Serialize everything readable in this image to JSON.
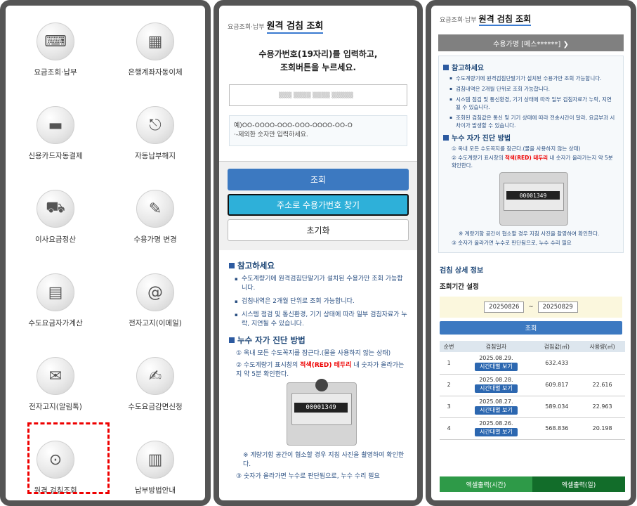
{
  "panel1": {
    "menu": [
      {
        "label": "요금조회·납부",
        "icon": "keyboard-icon",
        "glyph": "⌨"
      },
      {
        "label": "은행계좌자동이체",
        "icon": "calculator-icon",
        "glyph": "▦"
      },
      {
        "label": "신용카드자동결제",
        "icon": "credit-card-icon",
        "glyph": "▬"
      },
      {
        "label": "자동납부해지",
        "icon": "esc-key-icon",
        "glyph": "⎋"
      },
      {
        "label": "이사요금정산",
        "icon": "truck-icon",
        "glyph": "⛟"
      },
      {
        "label": "수용가명 변경",
        "icon": "pen-icon",
        "glyph": "✎"
      },
      {
        "label": "수도요금자가계산",
        "icon": "calculator-icon",
        "glyph": "▤"
      },
      {
        "label": "전자고지(이메일)",
        "icon": "email-at-icon",
        "glyph": "@"
      },
      {
        "label": "전자고지(알림톡)",
        "icon": "talk-icon",
        "glyph": "✉"
      },
      {
        "label": "수도요금감면신청",
        "icon": "document-pen-icon",
        "glyph": "✍"
      },
      {
        "label": "원격 검침조회",
        "icon": "water-meter-icon",
        "glyph": "⊙"
      },
      {
        "label": "납부방법안내",
        "icon": "book-icon",
        "glyph": "▥"
      }
    ]
  },
  "panel2": {
    "breadcrumb": "요금조회·납부",
    "title": "원격 검침 조회",
    "instruction_line1": "수용가번호(19자리)를 입력하고,",
    "instruction_line2": "조회버튼을 누르세요.",
    "input_value": "▒▒▒ ▒▒▒▒ ▒▒▒▒ ▒▒▒▒▒",
    "example_line1": "예)OO-OOOO-OOO-OOO-OOOO-OO-O",
    "example_line2": "·-제외한 숫자만 입력하세요.",
    "search_button": "조회",
    "find_by_address_button": "주소로 수용가번호 찾기",
    "reset_button": "초기화",
    "notes_title": "참고하세요",
    "notes": [
      "수도계량기에 원격검침단말기가 설치된 수용가만 조회 가능합니다.",
      "검침내역은 2개월 단위로 조회 가능합니다.",
      "시스템 점검 및 통신환경, 기기 상태에 따라 일부 검침자료가 누락, 지연될 수 있습니다."
    ],
    "leak_title": "누수 자가 진단 방법",
    "leak_step1": "① 옥내 모든 수도꼭지를 잠근다.(물을 사용하지 않는 상태)",
    "leak_step2_pre": "② 수도계량기 표시창의 ",
    "leak_step2_red": "적색(RED) 테두리",
    "leak_step2_post": " 내 숫자가 올라가는지 약 5분 확인한다.",
    "meter_digits": "00001349",
    "leak_note": "※ 계량기함 공간이 협소할 경우 지침 사진을 촬영하여 확인한다.",
    "leak_step3": "③ 숫자가 올라가면 누수로 판단됨으로, 누수 수리 필요"
  },
  "panel3": {
    "breadcrumb": "요금조회·납부",
    "title": "원격 검침 조회",
    "customer_bar": "수용가명 [메스******] ❯",
    "notes_title": "참고하세요",
    "notes": [
      "수도계량기에 원격검침단말기가 설치된 수용가만 조회 가능합니다.",
      "검침내역은 2개월 단위로 조회 가능합니다.",
      "시스템 점검 및 통신환경, 기기 상태에 따라 일부 검침자료가 누락, 지연될 수 있습니다.",
      "조회된 검침값은 통신 및 기기 상태에 따라 전송시간이 달라, 요금부과 시 차이가 발생할 수 있습니다."
    ],
    "leak_title": "누수 자가 진단 방법",
    "leak_step1": "① 옥내 모든 수도꼭지를 잠근다.(물을 사용하지 않는 상태)",
    "leak_step2_pre": "② 수도계량기 표시창의 ",
    "leak_step2_red": "적색(RED) 테두리",
    "leak_step2_post": " 내 숫자가 올라가는지 약 5분 확인한다.",
    "meter_digits": "00001349",
    "leak_note": "※ 계량기함 공간이 협소할 경우 지침 사진을 촬영하여 확인한다.",
    "leak_step3": "③ 숫자가 올라가면 누수로 판단됨으로, 누수 수리 필요",
    "detail_title": "검침 상세 정보",
    "period_title": "조회기간 설정",
    "date_from": "20250826",
    "date_sep": "~",
    "date_to": "20250829",
    "search_button": "조회",
    "table": {
      "headers": [
        "순번",
        "검침일자",
        "검침값(㎥)",
        "사용량(㎥)"
      ],
      "rows": [
        {
          "no": "1",
          "date": "2025.08.29.",
          "btn": "시간대별 보기",
          "value": "632.433",
          "usage": ""
        },
        {
          "no": "2",
          "date": "2025.08.28.",
          "btn": "시간대별 보기",
          "value": "609.817",
          "usage": "22.616"
        },
        {
          "no": "3",
          "date": "2025.08.27.",
          "btn": "시간대별 보기",
          "value": "589.034",
          "usage": "22.963"
        },
        {
          "no": "4",
          "date": "2025.08.26.",
          "btn": "시간대별 보기",
          "value": "568.836",
          "usage": "20.198"
        }
      ]
    },
    "excel_hour": "엑셀출력(시간)",
    "excel_day": "엑셀출력(일)"
  },
  "colors": {
    "frame": "#555555",
    "primary_blue": "#3c79c1",
    "cyan": "#2eb0d9",
    "excel_green_light": "#2e9a48",
    "excel_green_dark": "#126d2a",
    "highlight_red": "#ee0000"
  }
}
